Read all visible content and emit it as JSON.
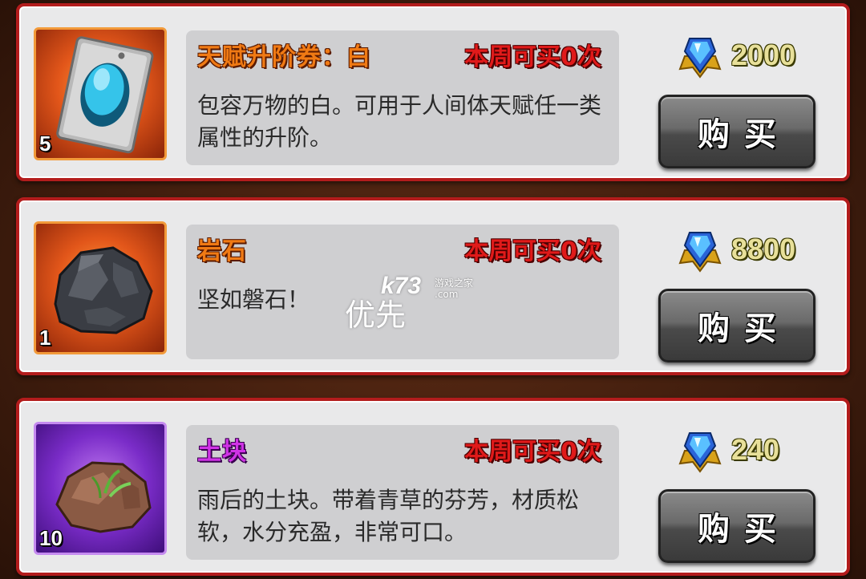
{
  "items": [
    {
      "name": "天赋升阶券：白",
      "limit": "本周可买0次",
      "desc": "包容万物的白。可用于人间体天赋任一类属性的升阶。",
      "count": "5",
      "price": "2000",
      "buy_label": "购买",
      "icon": "talent-ticket-icon",
      "rarity_color": "#f07a14"
    },
    {
      "name": "岩石",
      "limit": "本周可买0次",
      "desc": "坚如磐石！",
      "count": "1",
      "price": "8800",
      "buy_label": "购买",
      "icon": "rock-icon",
      "rarity_color": "#f07a14"
    },
    {
      "name": "土块",
      "limit": "本周可买0次",
      "desc": "雨后的土块。带着青草的芬芳，材质松软，水分充盈，非常可口。",
      "count": "10",
      "price": "240",
      "buy_label": "购买",
      "icon": "dirt-clod-icon",
      "rarity_color": "#d033e6"
    }
  ],
  "currency_icon": "blue-gem-icon",
  "watermark": {
    "logo": "k73",
    "site": "游戏之家",
    "domain": ".com",
    "text": "优先"
  }
}
